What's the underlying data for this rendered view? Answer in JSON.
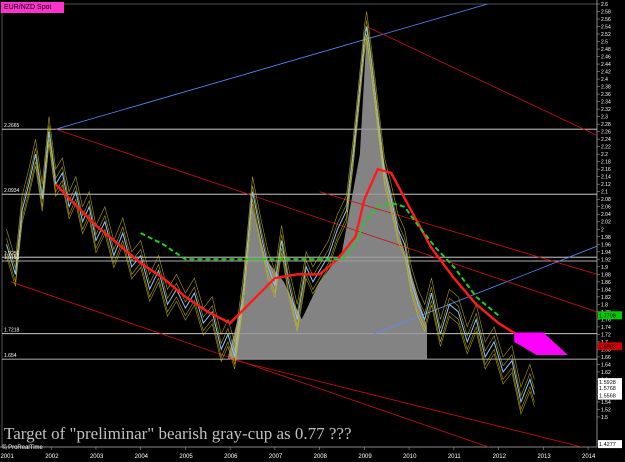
{
  "window": {
    "instrument_tab": "EUR/NZD Spot",
    "footer_credit": "© ProRealTime",
    "overlay_text": "Target of \"preliminar\" bearish gray-cup as 0.77 ???"
  },
  "chart_data": {
    "type": "line",
    "title": "EUR/NZD Spot",
    "xlabel": "",
    "ylabel": "",
    "x_tick_labels": [
      "2001",
      "2002",
      "2003",
      "2004",
      "2005",
      "2006",
      "2007",
      "2008",
      "2009",
      "2010",
      "2011",
      "2012",
      "2013",
      "2014"
    ],
    "y_tick_labels": [
      "2.6",
      "2.58",
      "2.56",
      "2.54",
      "2.52",
      "2.5",
      "2.48",
      "2.46",
      "2.44",
      "2.42",
      "2.4",
      "2.38",
      "2.36",
      "2.34",
      "2.32",
      "2.3",
      "2.28",
      "2.26",
      "2.24",
      "2.22",
      "2.2",
      "2.18",
      "2.16",
      "2.14",
      "2.12",
      "2.1",
      "2.08",
      "2.06",
      "2.04",
      "2.02",
      "2",
      "1.98",
      "1.96",
      "1.94",
      "1.92",
      "1.9",
      "1.88",
      "1.86",
      "1.84",
      "1.82",
      "1.8",
      "1.78",
      "1.76",
      "1.74",
      "1.72",
      "1.7",
      "1.68",
      "1.66",
      "1.64",
      "1.62",
      "1.6",
      "1.58",
      "1.56",
      "1.54",
      "1.52",
      "1.5"
    ],
    "ylim": [
      1.42,
      2.6
    ],
    "xlim": [
      2000.9,
      2014.2
    ],
    "grid": false,
    "horizontal_levels": [
      {
        "value": 2.2665,
        "label": "2.2665"
      },
      {
        "value": 2.0934,
        "label": 2.0934
      },
      {
        "value": 1.9256,
        "label": "1.9256"
      },
      {
        "value": 1.9155,
        "label": "1.9155"
      },
      {
        "value": 1.7218,
        "label": "1.7218"
      },
      {
        "value": 1.654,
        "label": "1.654"
      }
    ],
    "price_boxes": [
      {
        "value": 1.7708,
        "label": "1.7708",
        "color": "#00cc00"
      },
      {
        "value": 1.6882,
        "label": "1.6882",
        "color": "#cc0000"
      },
      {
        "value": 1.5928,
        "label": "1.5928",
        "color": "#ffffff"
      },
      {
        "value": 1.5768,
        "label": "1.5768",
        "color": "#ffffff"
      },
      {
        "value": 1.5568,
        "label": "1.5568",
        "color": "#ffffff"
      },
      {
        "value": 1.4277,
        "label": "1.4277",
        "color": "#ffffff"
      }
    ],
    "series": [
      {
        "color": "#8fc3ff",
        "x": [
          2001.0,
          2001.2,
          2001.35,
          2001.5,
          2001.65,
          2001.8,
          2001.95,
          2002.1,
          2002.25,
          2002.4,
          2002.55,
          2002.7,
          2002.85,
          2003.0,
          2003.2,
          2003.4,
          2003.6,
          2003.8,
          2004.0,
          2004.2,
          2004.4,
          2004.6,
          2004.8,
          2005.0,
          2005.2,
          2005.4,
          2005.6,
          2005.8,
          2005.95,
          2006.1,
          2006.3,
          2006.5,
          2006.7,
          2006.85,
          2007.0,
          2007.15,
          2007.3,
          2007.5,
          2007.7,
          2007.85,
          2008.0,
          2008.2,
          2008.4,
          2008.6,
          2008.75,
          2008.9,
          2009.0,
          2009.05,
          2009.15,
          2009.3,
          2009.45,
          2009.6,
          2009.75,
          2009.9,
          2010.05,
          2010.2,
          2010.35,
          2010.5,
          2010.7,
          2010.9,
          2011.1,
          2011.3,
          2011.5,
          2011.7,
          2011.9,
          2012.1,
          2012.3,
          2012.5,
          2012.7,
          2012.8
        ],
        "y": [
          1.96,
          1.88,
          2.05,
          2.12,
          2.2,
          2.08,
          2.26,
          2.12,
          2.15,
          2.06,
          2.1,
          2.02,
          2.06,
          1.97,
          2.02,
          1.93,
          1.99,
          1.9,
          1.93,
          1.84,
          1.89,
          1.8,
          1.84,
          1.79,
          1.83,
          1.75,
          1.78,
          1.68,
          1.72,
          1.66,
          1.84,
          2.1,
          1.98,
          1.9,
          1.85,
          1.97,
          1.86,
          1.76,
          1.9,
          1.86,
          1.89,
          1.93,
          2.0,
          2.05,
          2.2,
          2.38,
          2.5,
          2.54,
          2.45,
          2.3,
          2.15,
          2.08,
          2.0,
          1.96,
          1.86,
          1.8,
          1.76,
          1.83,
          1.72,
          1.8,
          1.78,
          1.7,
          1.76,
          1.66,
          1.7,
          1.62,
          1.65,
          1.54,
          1.6,
          1.56
        ]
      },
      {
        "color": "#ff1a1a",
        "x": [
          2002.1,
          2002.5,
          2003.0,
          2003.5,
          2004.0,
          2004.5,
          2005.0,
          2005.5,
          2006.0,
          2006.5,
          2007.0,
          2007.5,
          2008.0,
          2008.4,
          2008.8,
          2009.0,
          2009.3,
          2009.6,
          2010.0,
          2010.5,
          2011.0,
          2011.5,
          2012.0,
          2012.4,
          2012.6
        ],
        "y": [
          2.12,
          2.07,
          2.01,
          1.96,
          1.91,
          1.87,
          1.82,
          1.78,
          1.75,
          1.81,
          1.87,
          1.88,
          1.88,
          1.92,
          1.98,
          2.08,
          2.16,
          2.15,
          2.06,
          1.95,
          1.87,
          1.8,
          1.75,
          1.72,
          1.7
        ]
      },
      {
        "color": "#22cc22",
        "x": [
          2004.0,
          2004.5,
          2005.0,
          2008.5,
          2008.8,
          2009.0,
          2009.3,
          2009.6,
          2009.9,
          2010.2,
          2010.6,
          2011.0,
          2011.5,
          2012.0
        ],
        "y": [
          1.99,
          1.96,
          1.92,
          1.92,
          1.96,
          2.02,
          2.06,
          2.07,
          2.06,
          2.01,
          1.95,
          1.9,
          1.82,
          1.77
        ]
      }
    ],
    "gray_cup": {
      "color": "#9a9a9a",
      "x": [
        2005.95,
        2006.3,
        2006.5,
        2006.8,
        2007.2,
        2007.6,
        2008.0,
        2008.5,
        2008.9,
        2009.05,
        2009.4,
        2009.8,
        2010.1,
        2010.4
      ],
      "y": [
        1.66,
        1.82,
        2.06,
        1.92,
        1.86,
        1.76,
        1.86,
        1.94,
        2.2,
        2.52,
        2.2,
        1.98,
        1.86,
        1.74
      ],
      "base": 1.654
    },
    "channel_lines": [
      {
        "color": "#5b8cff",
        "x": [
          2002.1,
          2013.2
        ],
        "y": [
          2.2665,
          2.65
        ]
      },
      {
        "color": "#5b8cff",
        "x": [
          2009.2,
          2014.2
        ],
        "y": [
          1.72,
          1.955
        ]
      },
      {
        "color": "#cc1111",
        "x": [
          2002.1,
          2014.2
        ],
        "y": [
          2.2665,
          1.78
        ]
      },
      {
        "color": "#cc1111",
        "x": [
          2006.0,
          2014.2
        ],
        "y": [
          1.654,
          1.41
        ]
      },
      {
        "color": "#cc1111",
        "x": [
          2009.05,
          2014.2
        ],
        "y": [
          2.54,
          2.25
        ]
      },
      {
        "color": "#cc1111",
        "x": [
          2001.1,
          2014.2
        ],
        "y": [
          1.86,
          1.32
        ]
      },
      {
        "color": "#cc1111",
        "x": [
          2008.0,
          2014.2
        ],
        "y": [
          2.1,
          1.88
        ]
      }
    ],
    "target_zone": {
      "color": "#ff00ff",
      "points": [
        [
          2012.35,
          1.725
        ],
        [
          2013.0,
          1.725
        ],
        [
          2013.55,
          1.665
        ],
        [
          2012.85,
          1.665
        ],
        [
          2012.35,
          1.7
        ]
      ]
    }
  }
}
